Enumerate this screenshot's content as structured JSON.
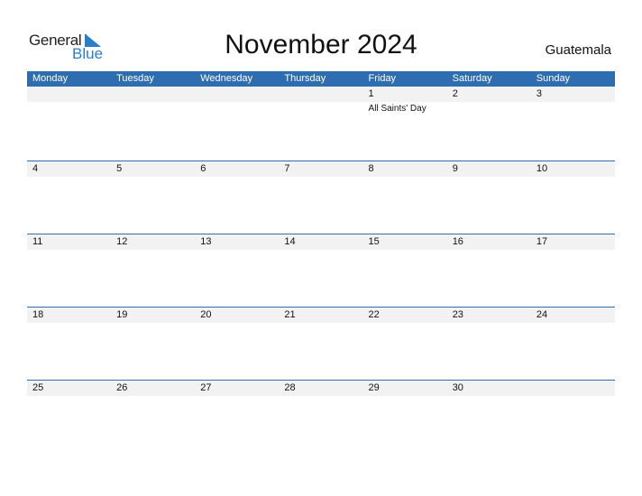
{
  "logo": {
    "word1": "General",
    "word2": "Blue"
  },
  "title": "November 2024",
  "country": "Guatemala",
  "weekdays": [
    "Monday",
    "Tuesday",
    "Wednesday",
    "Thursday",
    "Friday",
    "Saturday",
    "Sunday"
  ],
  "weeks": [
    [
      {
        "day": ""
      },
      {
        "day": ""
      },
      {
        "day": ""
      },
      {
        "day": ""
      },
      {
        "day": "1",
        "holiday": "All Saints' Day"
      },
      {
        "day": "2"
      },
      {
        "day": "3"
      }
    ],
    [
      {
        "day": "4"
      },
      {
        "day": "5"
      },
      {
        "day": "6"
      },
      {
        "day": "7"
      },
      {
        "day": "8"
      },
      {
        "day": "9"
      },
      {
        "day": "10"
      }
    ],
    [
      {
        "day": "11"
      },
      {
        "day": "12"
      },
      {
        "day": "13"
      },
      {
        "day": "14"
      },
      {
        "day": "15"
      },
      {
        "day": "16"
      },
      {
        "day": "17"
      }
    ],
    [
      {
        "day": "18"
      },
      {
        "day": "19"
      },
      {
        "day": "20"
      },
      {
        "day": "21"
      },
      {
        "day": "22"
      },
      {
        "day": "23"
      },
      {
        "day": "24"
      }
    ],
    [
      {
        "day": "25"
      },
      {
        "day": "26"
      },
      {
        "day": "27"
      },
      {
        "day": "28"
      },
      {
        "day": "29"
      },
      {
        "day": "30"
      },
      {
        "day": ""
      }
    ]
  ],
  "colors": {
    "accent": "#2e6eb0",
    "logo_blue": "#2a7dc9",
    "band": "#f2f2f2"
  }
}
